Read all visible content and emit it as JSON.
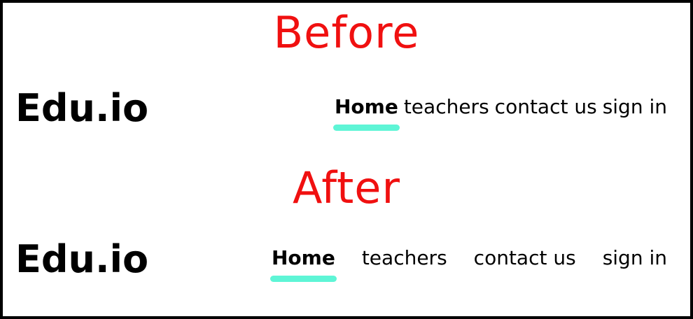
{
  "colors": {
    "caption": "#f01010",
    "accent": "#5ef5d6",
    "text": "#000000",
    "border": "#000000",
    "background": "#ffffff"
  },
  "before": {
    "caption": "Before",
    "logo": "Edu.io",
    "nav": [
      "Home",
      "teachers",
      "contact us",
      "sign in"
    ],
    "active_index": 0
  },
  "after": {
    "caption": "After",
    "logo": "Edu.io",
    "nav": [
      "Home",
      "teachers",
      "contact us",
      "sign in"
    ],
    "active_index": 0
  }
}
